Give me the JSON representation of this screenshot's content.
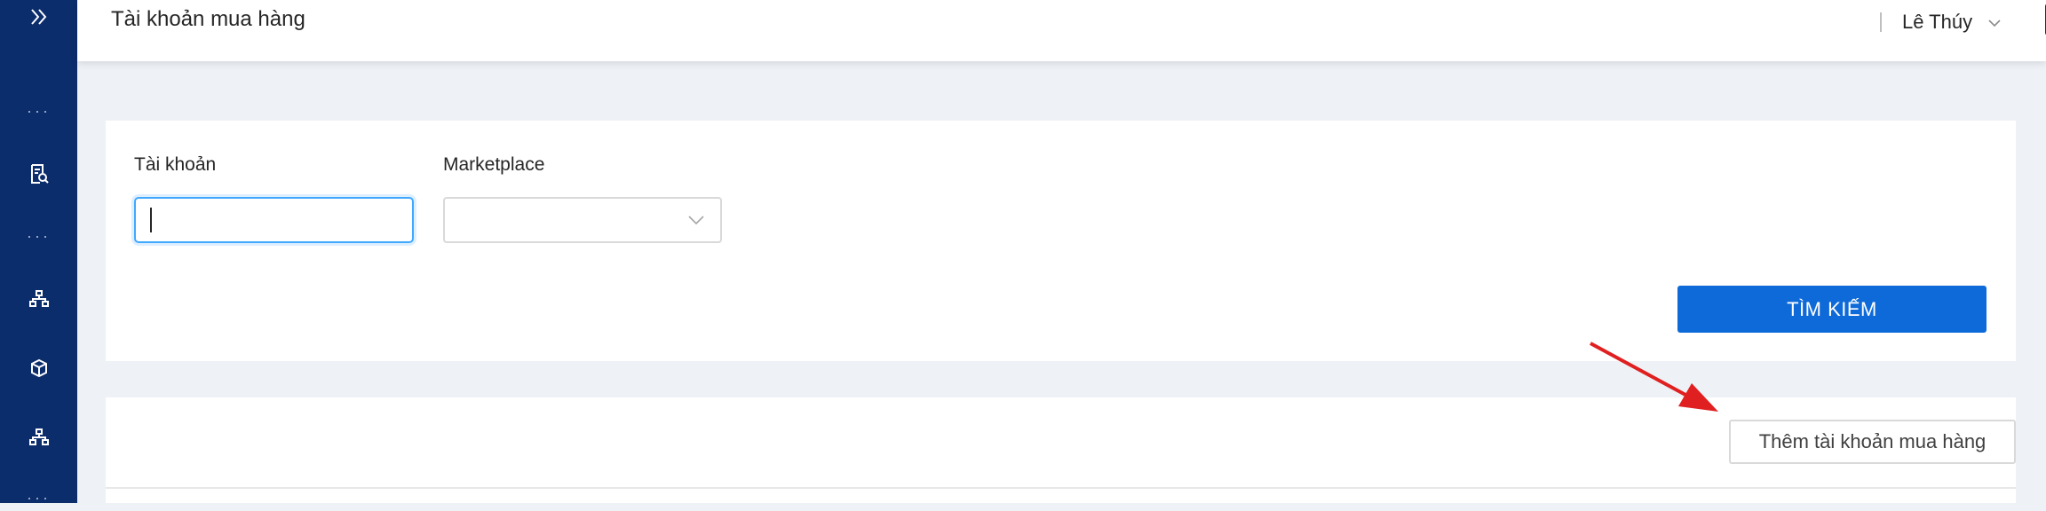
{
  "header": {
    "title": "Tài khoản mua hàng",
    "user_name": "Lê Thúy"
  },
  "sidebar": {
    "items": [
      {
        "icon": "chevrons-right-icon"
      },
      {
        "icon": "more-dots-icon",
        "label": "···"
      },
      {
        "icon": "document-search-icon"
      },
      {
        "icon": "more-dots-icon",
        "label": "···"
      },
      {
        "icon": "org-chart-icon"
      },
      {
        "icon": "cube-icon"
      },
      {
        "icon": "org-chart-icon"
      },
      {
        "icon": "more-dots-icon",
        "label": "···"
      }
    ]
  },
  "search": {
    "account_label": "Tài khoản",
    "account_value": "",
    "marketplace_label": "Marketplace",
    "marketplace_value": "",
    "search_button": "TÌM KIẾM"
  },
  "list": {
    "add_button": "Thêm tài khoản mua hàng"
  },
  "colors": {
    "sidebar_bg": "#0c2d6b",
    "primary_button": "#0e6ad8",
    "annotation_arrow": "#e02020"
  }
}
